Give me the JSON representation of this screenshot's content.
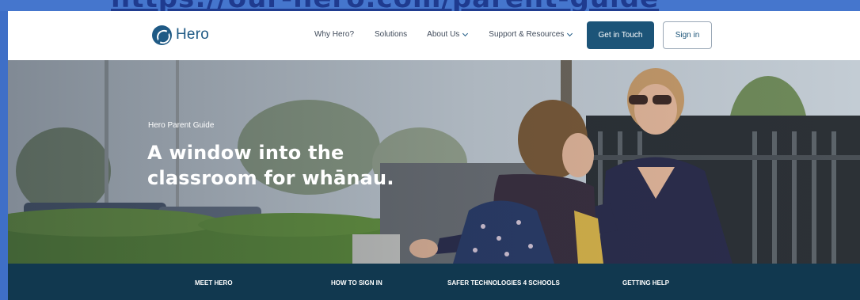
{
  "browser": {
    "url_fragment": "https://our-hero.com/parent-guide"
  },
  "header": {
    "logo_text": "Hero",
    "nav": [
      {
        "label": "Why Hero?",
        "has_dropdown": false
      },
      {
        "label": "Solutions",
        "has_dropdown": false
      },
      {
        "label": "About Us",
        "has_dropdown": true
      },
      {
        "label": "Support & Resources",
        "has_dropdown": true
      }
    ],
    "cta_label": "Get in Touch",
    "signin_label": "Sign in"
  },
  "hero": {
    "eyebrow": "Hero Parent Guide",
    "title_line1": "A window into the",
    "title_line2": "classroom for whānau."
  },
  "tabs": [
    {
      "label": "MEET HERO"
    },
    {
      "label": "HOW TO SIGN IN"
    },
    {
      "label": "SAFER TECHNOLOGIES 4 SCHOOLS"
    },
    {
      "label": "GETTING HELP"
    }
  ],
  "colors": {
    "brand": "#1f5a85",
    "cta": "#1c5478",
    "tabbar": "#11384f",
    "frame": "#3f6fc7"
  }
}
